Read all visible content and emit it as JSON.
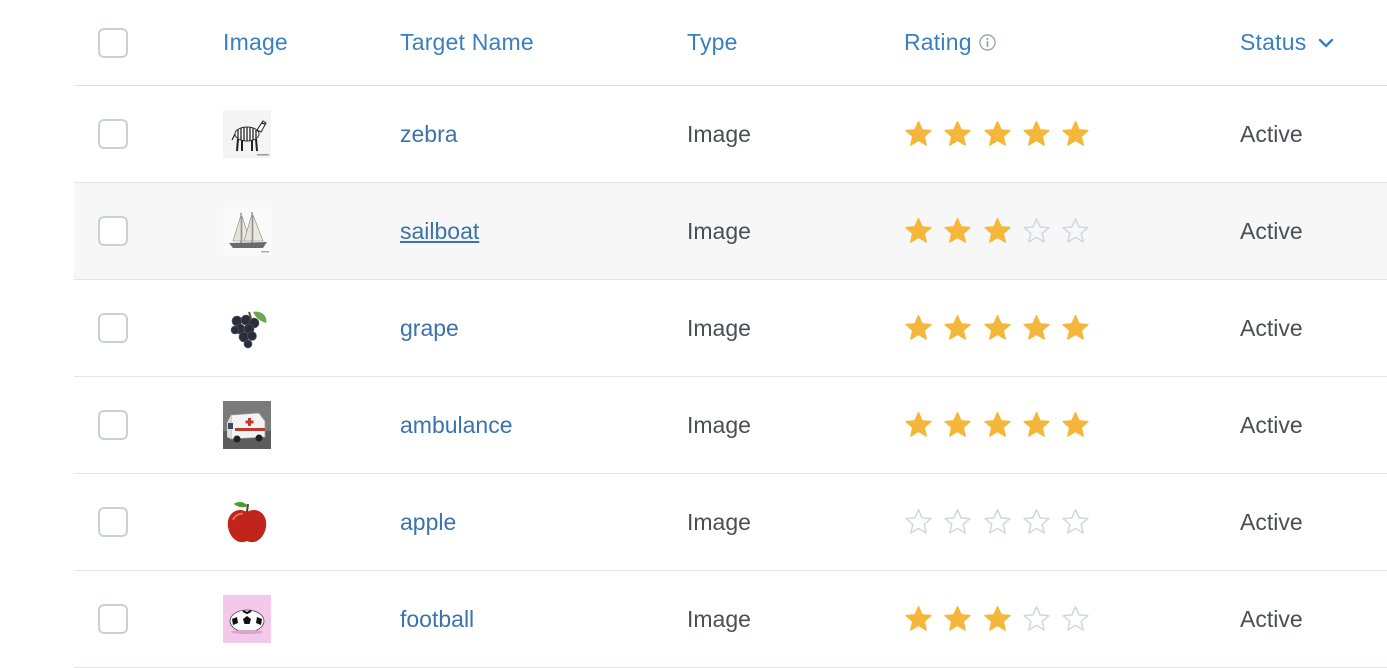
{
  "columns": {
    "image": "Image",
    "target_name": "Target Name",
    "type": "Type",
    "rating": "Rating",
    "status": "Status"
  },
  "icons": {
    "rating_info": "info-icon",
    "status_sort": "chevron-down-icon",
    "star_filled": "star-filled-icon",
    "star_empty": "star-empty-icon"
  },
  "colors": {
    "accent": "#3a7fc1",
    "link": "#3a73ad",
    "star_filled": "#f5b73b",
    "star_empty": "#d3d6da",
    "row_hover": "#f7f7f7"
  },
  "rows": [
    {
      "name": "zebra",
      "thumbnail": "zebra",
      "type": "Image",
      "rating": 5,
      "status": "Active"
    },
    {
      "name": "sailboat",
      "thumbnail": "sailboat",
      "type": "Image",
      "rating": 3,
      "status": "Active"
    },
    {
      "name": "grape",
      "thumbnail": "grape",
      "type": "Image",
      "rating": 5,
      "status": "Active"
    },
    {
      "name": "ambulance",
      "thumbnail": "ambulance",
      "type": "Image",
      "rating": 5,
      "status": "Active"
    },
    {
      "name": "apple",
      "thumbnail": "apple",
      "type": "Image",
      "rating": 0,
      "status": "Active"
    },
    {
      "name": "football",
      "thumbnail": "football",
      "type": "Image",
      "rating": 3,
      "status": "Active"
    }
  ],
  "rating_max": 5
}
